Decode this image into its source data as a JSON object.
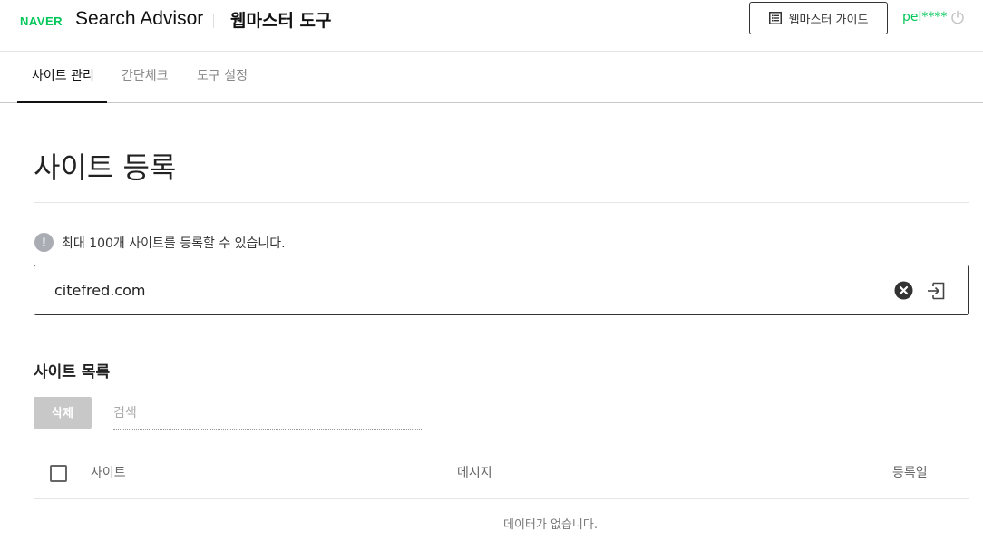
{
  "header": {
    "logo": "NAVER",
    "product": "Search Advisor",
    "section_title": "웹마스터 도구",
    "guide_button": "웹마스터 가이드",
    "user_id": "pel****",
    "logout_icon": "power-icon"
  },
  "tabs": [
    {
      "label": "사이트 관리",
      "active": true
    },
    {
      "label": "간단체크",
      "active": false
    },
    {
      "label": "도구 설정",
      "active": false
    }
  ],
  "main": {
    "title": "사이트 등록",
    "notice": "최대 100개 사이트를 등록할 수 있습니다.",
    "notice_icon": "info-icon",
    "url_input_value": "citefred.com",
    "clear_icon": "clear-icon",
    "submit_icon": "submit-icon"
  },
  "site_list": {
    "title": "사이트 목록",
    "delete_button": "삭제",
    "search_placeholder": "검색",
    "columns": [
      "사이트",
      "메시지",
      "등록일"
    ],
    "empty_message": "데이터가 없습니다."
  },
  "colors": {
    "brand": "#03c75a",
    "disabled_button": "#c8c8c8",
    "info_icon": "#a9acb3"
  }
}
